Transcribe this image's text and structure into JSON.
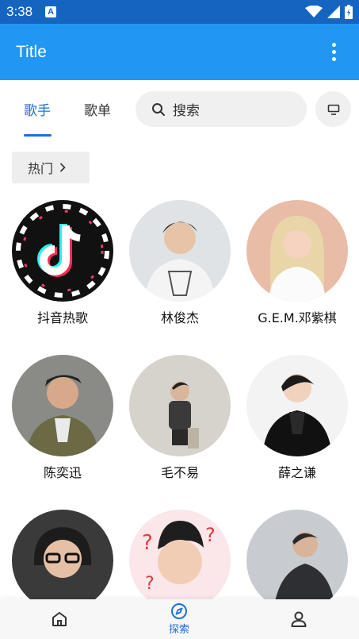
{
  "status_bar": {
    "time": "3:38",
    "badge": "A"
  },
  "app_bar": {
    "title": "Title",
    "menu_icon": "more-vert-icon"
  },
  "tabs": [
    {
      "label": "歌手",
      "active": true
    },
    {
      "label": "歌单",
      "active": false
    }
  ],
  "search": {
    "text": "搜索"
  },
  "filter": {
    "label": "热门"
  },
  "artists": [
    {
      "name": "抖音热歌"
    },
    {
      "name": "林俊杰"
    },
    {
      "name": "G.E.M.邓紫棋"
    },
    {
      "name": "陈奕迅"
    },
    {
      "name": "毛不易"
    },
    {
      "name": "薛之谦"
    },
    {
      "name": ""
    },
    {
      "name": ""
    },
    {
      "name": ""
    }
  ],
  "bottom_nav": [
    {
      "icon": "home-icon",
      "label": ""
    },
    {
      "icon": "compass-icon",
      "label": "探索",
      "active": true
    },
    {
      "icon": "person-icon",
      "label": ""
    }
  ],
  "colors": {
    "status_bar": "#1565c0",
    "app_bar": "#2196f3",
    "accent": "#1e6fd9"
  }
}
